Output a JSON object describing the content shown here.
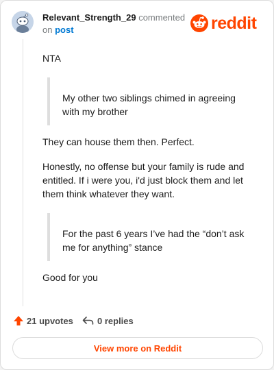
{
  "header": {
    "username": "Relevant_Strength_29",
    "commented_text": "commented",
    "on_text": "on",
    "post_link": "post",
    "logo_text": "reddit"
  },
  "comment": {
    "p1": "NTA",
    "quote1": "My other two siblings chimed in agreeing with my brother",
    "p2": "They can house them then. Perfect.",
    "p3": "Honestly, no offense but your family is rude and entitled. If i were you, i'd just block them and let them think whatever they want.",
    "quote2": "For the past 6 years I’ve had the “don’t ask me for anything” stance",
    "p4": "Good for you"
  },
  "footer": {
    "upvotes": "21 upvotes",
    "replies": "0 replies",
    "view_more": "View more on Reddit"
  },
  "colors": {
    "brand": "#ff4500",
    "link": "#0079d3"
  },
  "icons": {
    "avatar": "snoo-avatar-icon",
    "logo": "reddit-logo-icon",
    "upvote": "upvote-arrow-icon",
    "reply": "reply-arrow-icon"
  }
}
